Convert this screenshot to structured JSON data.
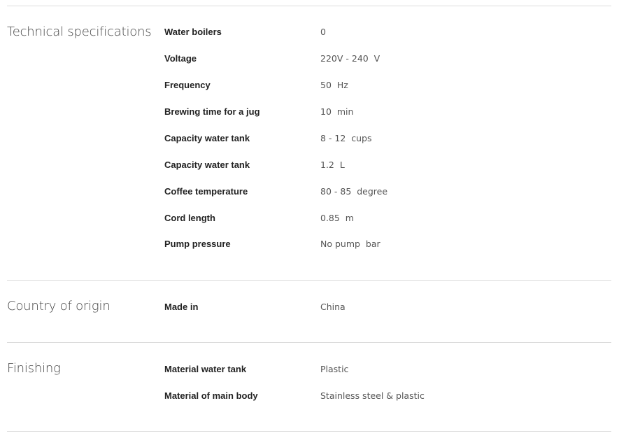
{
  "sections": [
    {
      "title": "Technical specifications",
      "rows": [
        {
          "label": "Water boilers",
          "value": "0"
        },
        {
          "label": "Voltage",
          "value": "220V - 240  V"
        },
        {
          "label": "Frequency",
          "value": "50  Hz"
        },
        {
          "label": "Brewing time for a jug",
          "value": "10  min"
        },
        {
          "label": "Capacity water tank",
          "value": "8 - 12  cups"
        },
        {
          "label": "Capacity water tank",
          "value": "1.2  L"
        },
        {
          "label": "Coffee temperature",
          "value": "80 - 85  degree"
        },
        {
          "label": "Cord length",
          "value": "0.85  m"
        },
        {
          "label": "Pump pressure",
          "value": "No pump  bar"
        }
      ]
    },
    {
      "title": "Country of origin",
      "rows": [
        {
          "label": "Made in",
          "value": "China"
        }
      ]
    },
    {
      "title": "Finishing",
      "rows": [
        {
          "label": "Material water tank",
          "value": "Plastic"
        },
        {
          "label": "Material of main body",
          "value": "Stainless steel & plastic"
        }
      ]
    }
  ]
}
